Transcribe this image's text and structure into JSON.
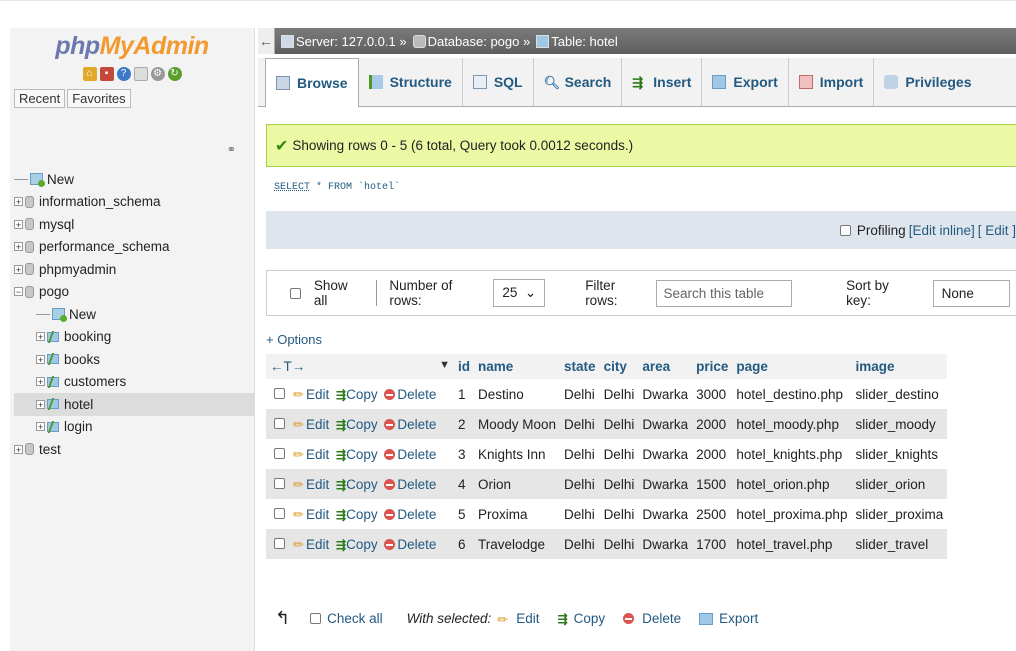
{
  "app": {
    "logo_a": "php",
    "logo_b": "MyAdmin"
  },
  "sidebar": {
    "recent": "Recent",
    "favorites": "Favorites",
    "tree": [
      {
        "label": "New",
        "type": "new",
        "level": 0
      },
      {
        "label": "information_schema",
        "type": "db",
        "level": 0
      },
      {
        "label": "mysql",
        "type": "db",
        "level": 0
      },
      {
        "label": "performance_schema",
        "type": "db",
        "level": 0
      },
      {
        "label": "phpmyadmin",
        "type": "db",
        "level": 0
      },
      {
        "label": "pogo",
        "type": "db",
        "level": 0,
        "expanded": true
      },
      {
        "label": "New",
        "type": "new",
        "level": 1
      },
      {
        "label": "booking",
        "type": "table",
        "level": 1
      },
      {
        "label": "books",
        "type": "table",
        "level": 1
      },
      {
        "label": "customers",
        "type": "table",
        "level": 1
      },
      {
        "label": "hotel",
        "type": "table",
        "level": 1,
        "selected": true
      },
      {
        "label": "login",
        "type": "table",
        "level": 1
      },
      {
        "label": "test",
        "type": "db",
        "level": 0
      }
    ]
  },
  "breadcrumb": {
    "server": "Server: 127.0.0.1 »",
    "database": "Database: pogo »",
    "table": "Table: hotel"
  },
  "tabs": [
    "Browse",
    "Structure",
    "SQL",
    "Search",
    "Insert",
    "Export",
    "Import",
    "Privileges"
  ],
  "message": "Showing rows 0 - 5 (6 total, Query took 0.0012 seconds.)",
  "query": {
    "select": "SELECT",
    "rest": " * FROM `hotel`"
  },
  "profiling": {
    "label": "Profiling",
    "edit_inline": "[Edit inline]",
    "edit": "[ Edit ]"
  },
  "nav": {
    "show_all": "Show all",
    "num_rows_label": "Number of rows:",
    "num_rows_value": "25",
    "filter_label": "Filter rows:",
    "filter_placeholder": "Search this table",
    "sort_label": "Sort by key:",
    "sort_value": "None"
  },
  "options_label": "+ Options",
  "table": {
    "arrows": "←T→",
    "sort_arrow": "▼",
    "columns": [
      "id",
      "name",
      "state",
      "city",
      "area",
      "price",
      "page",
      "image"
    ],
    "actions": {
      "edit": "Edit",
      "copy": "Copy",
      "delete": "Delete"
    },
    "rows": [
      [
        "1",
        "Destino",
        "Delhi",
        "Delhi",
        "Dwarka",
        "3000",
        "hotel_destino.php",
        "slider_destino"
      ],
      [
        "2",
        "Moody Moon",
        "Delhi",
        "Delhi",
        "Dwarka",
        "2000",
        "hotel_moody.php",
        "slider_moody"
      ],
      [
        "3",
        "Knights Inn",
        "Delhi",
        "Delhi",
        "Dwarka",
        "2000",
        "hotel_knights.php",
        "slider_knights"
      ],
      [
        "4",
        "Orion",
        "Delhi",
        "Delhi",
        "Dwarka",
        "1500",
        "hotel_orion.php",
        "slider_orion"
      ],
      [
        "5",
        "Proxima",
        "Delhi",
        "Delhi",
        "Dwarka",
        "2500",
        "hotel_proxima.php",
        "slider_proxima"
      ],
      [
        "6",
        "Travelodge",
        "Delhi",
        "Delhi",
        "Dwarka",
        "1700",
        "hotel_travel.php",
        "slider_travel"
      ]
    ]
  },
  "footer": {
    "check_all": "Check all",
    "with_selected": "With selected:",
    "edit": "Edit",
    "copy": "Copy",
    "delete": "Delete",
    "export": "Export"
  }
}
